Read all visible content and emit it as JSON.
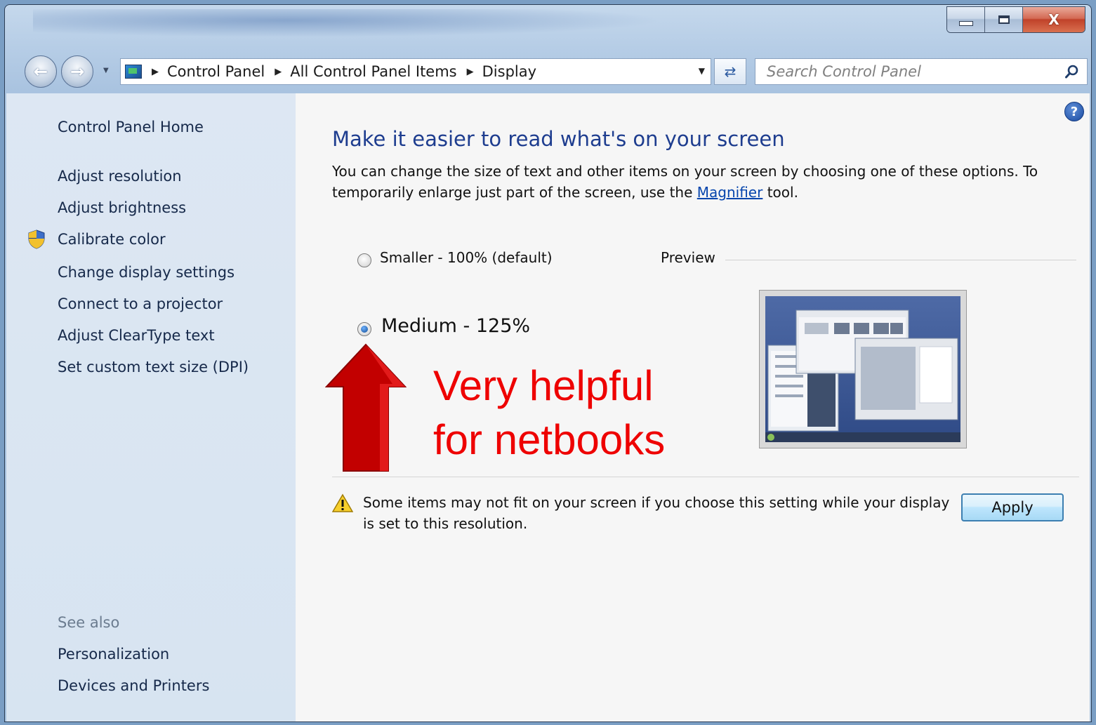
{
  "window": {
    "caption": {
      "minimize": "minimize",
      "maximize": "maximize",
      "close_glyph": "X"
    }
  },
  "navbar": {
    "breadcrumbs": [
      "Control Panel",
      "All Control Panel Items",
      "Display"
    ],
    "search_placeholder": "Search Control Panel"
  },
  "sidebar": {
    "home": "Control Panel Home",
    "items": [
      "Adjust resolution",
      "Adjust brightness",
      "Calibrate color",
      "Change display settings",
      "Connect to a projector",
      "Adjust ClearType text",
      "Set custom text size (DPI)"
    ],
    "see_also_label": "See also",
    "see_also": [
      "Personalization",
      "Devices and Printers"
    ]
  },
  "main": {
    "heading": "Make it easier to read what's on your screen",
    "desc_part1": "You can change the size of text and other items on your screen by choosing one of these options. To temporarily enlarge just part of the screen, use the ",
    "desc_link": "Magnifier",
    "desc_part2": " tool.",
    "options": [
      {
        "label": "Smaller - 100% (default)",
        "selected": false
      },
      {
        "label": "Medium - 125%",
        "selected": true
      }
    ],
    "preview_label": "Preview",
    "warning": "Some items may not fit on your screen if you choose this setting while your display is set to this resolution.",
    "apply": "Apply"
  },
  "annotation": {
    "line1": "Very helpful",
    "line2": "for netbooks",
    "color": "#ee0000"
  },
  "icons": {
    "shield": "uac-shield-icon",
    "help": "help-icon",
    "warning": "warning-icon",
    "search": "search-icon"
  }
}
